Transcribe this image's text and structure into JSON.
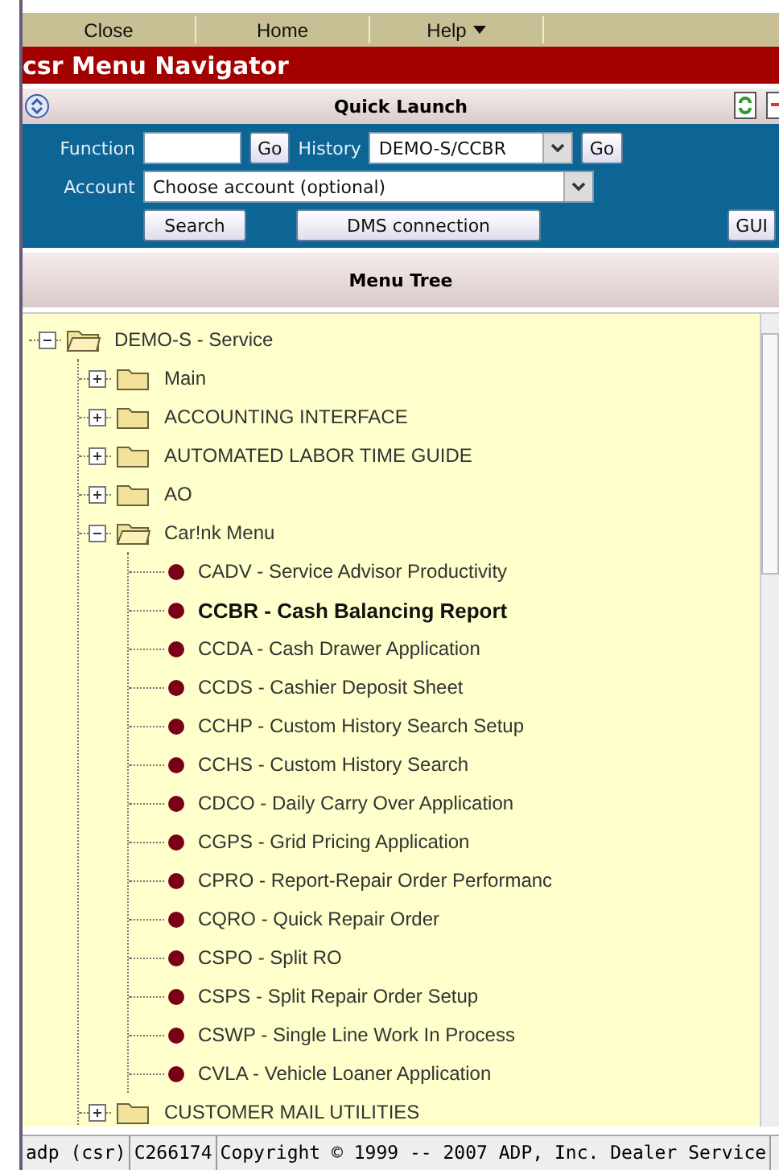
{
  "menu_bar": [
    {
      "label": "Close",
      "kind": "plain"
    },
    {
      "label": "Home",
      "kind": "plain"
    },
    {
      "label": "Help",
      "kind": "dropdown"
    }
  ],
  "title": "csr Menu Navigator",
  "quick_launch": {
    "title": "Quick Launch",
    "function_label": "Function",
    "go_label": "Go",
    "history_label": "History",
    "history_value": "DEMO-S/CCBR",
    "history_go": "Go",
    "account_label": "Account",
    "account_value": "Choose account (optional)",
    "buttons": [
      "Search",
      "DMS connection",
      "GUI"
    ]
  },
  "menu_tree": {
    "title": "Menu Tree",
    "items": [
      {
        "kind": "folder",
        "label": "DEMO-S - Service",
        "expanded": true,
        "children": [
          {
            "kind": "folder",
            "label": "Main",
            "expanded": false
          },
          {
            "kind": "folder",
            "label": "ACCOUNTING INTERFACE",
            "expanded": false
          },
          {
            "kind": "folder",
            "label": "AUTOMATED LABOR TIME GUIDE",
            "expanded": false
          },
          {
            "kind": "folder",
            "label": "AO",
            "expanded": false
          },
          {
            "kind": "folder",
            "label": "Car!nk Menu",
            "expanded": true,
            "children": [
              {
                "kind": "leaf",
                "label": "CADV - Service Advisor Productivity",
                "selected": false
              },
              {
                "kind": "leaf",
                "label": "CCBR - Cash Balancing Report",
                "selected": true
              },
              {
                "kind": "leaf",
                "label": "CCDA - Cash Drawer Application",
                "selected": false
              },
              {
                "kind": "leaf",
                "label": "CCDS - Cashier Deposit Sheet",
                "selected": false
              },
              {
                "kind": "leaf",
                "label": "CCHP - Custom History Search Setup",
                "selected": false
              },
              {
                "kind": "leaf",
                "label": "CCHS - Custom History Search",
                "selected": false
              },
              {
                "kind": "leaf",
                "label": "CDCO - Daily Carry Over Application",
                "selected": false
              },
              {
                "kind": "leaf",
                "label": "CGPS - Grid Pricing Application",
                "selected": false
              },
              {
                "kind": "leaf",
                "label": "CPRO - Report-Repair Order Performanc",
                "selected": false
              },
              {
                "kind": "leaf",
                "label": "CQRO - Quick Repair Order",
                "selected": false
              },
              {
                "kind": "leaf",
                "label": "CSPO - Split RO",
                "selected": false
              },
              {
                "kind": "leaf",
                "label": "CSPS - Split Repair Order Setup",
                "selected": false
              },
              {
                "kind": "leaf",
                "label": "CSWP - Single Line Work In Process",
                "selected": false
              },
              {
                "kind": "leaf",
                "label": "CVLA - Vehicle Loaner Application",
                "selected": false
              }
            ]
          },
          {
            "kind": "folder",
            "label": "CUSTOMER MAIL UTILITIES",
            "expanded": false
          }
        ]
      }
    ]
  },
  "status_bar": [
    "adp (csr)",
    "C266174",
    "Copyright © 1999 -- 2007 ADP, Inc. Dealer Service"
  ]
}
